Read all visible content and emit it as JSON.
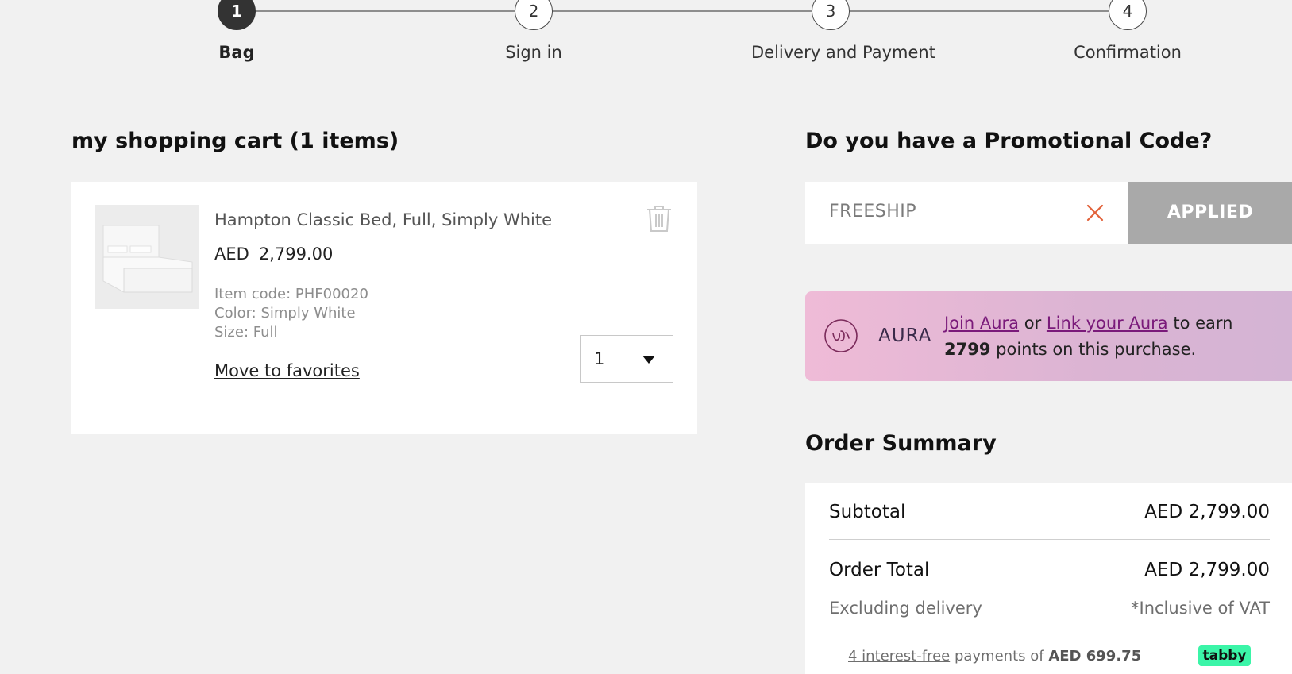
{
  "stepper": {
    "steps": [
      {
        "number": "1",
        "label": "Bag"
      },
      {
        "number": "2",
        "label": "Sign in"
      },
      {
        "number": "3",
        "label": "Delivery and Payment"
      },
      {
        "number": "4",
        "label": "Confirmation"
      }
    ],
    "active_step": 1
  },
  "cart": {
    "title": "my shopping cart (1 items)",
    "item": {
      "name": "Hampton Classic Bed, Full, Simply White",
      "currency": "AED",
      "price": "2,799.00",
      "item_code": "Item code: PHF00020",
      "color": "Color: Simply White",
      "size": "Size: Full",
      "move_to_favorites": "Move to favorites",
      "quantity": "1"
    }
  },
  "promo": {
    "title": "Do you have a Promotional Code?",
    "code_value": "FREESHIP",
    "applied_label": "APPLIED"
  },
  "aura": {
    "logo_text": "AURA",
    "join_link": "Join Aura",
    "or_text": "or",
    "link_link": "Link your Aura",
    "earn_text": "to earn",
    "points": "2799",
    "suffix": "points on this purchase."
  },
  "summary": {
    "title": "Order Summary",
    "subtotal_label": "Subtotal",
    "subtotal_value": "AED 2,799.00",
    "total_label": "Order Total",
    "total_value": "AED 2,799.00",
    "excluding_delivery": "Excluding delivery",
    "inclusive_vat": "*Inclusive of VAT",
    "tabby": {
      "link_text": "4 interest-free",
      "middle_text": "payments of",
      "amount": "AED 699.75",
      "badge": "tabby"
    }
  },
  "colors": {
    "background": "#f1f1f1",
    "active_step": "#333333",
    "applied_button": "#a9a9a9",
    "aura_link": "#7a1a7a",
    "tabby_badge": "#3bf5a8",
    "clear_x": "#e2623a"
  },
  "icons": {
    "trash": "trash-icon",
    "clear": "close-icon",
    "dropdown": "chevron-down-icon",
    "aura_logo": "aura-logo-icon"
  }
}
